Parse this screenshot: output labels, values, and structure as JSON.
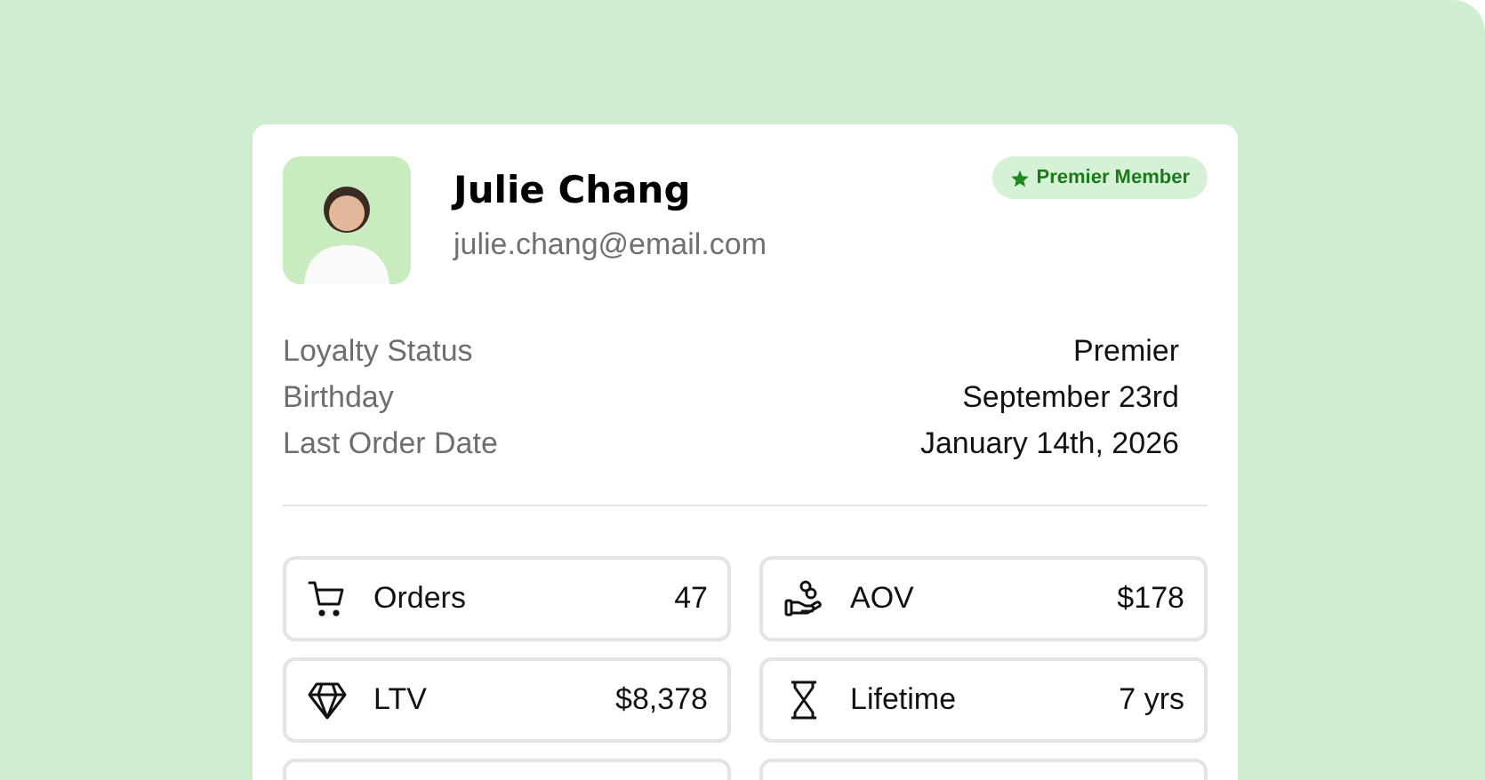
{
  "profile": {
    "name": "Julie Chang",
    "email": "julie.chang@email.com",
    "badge": "Premier Member"
  },
  "details": [
    {
      "label": "Loyalty Status",
      "value": "Premier"
    },
    {
      "label": "Birthday",
      "value": "September 23rd"
    },
    {
      "label": "Last Order Date",
      "value": "January 14th, 2026"
    }
  ],
  "stats": [
    {
      "label": "Orders",
      "value": "47"
    },
    {
      "label": "AOV",
      "value": "$178"
    },
    {
      "label": "LTV",
      "value": "$8,378"
    },
    {
      "label": "Lifetime",
      "value": "7 yrs"
    }
  ]
}
